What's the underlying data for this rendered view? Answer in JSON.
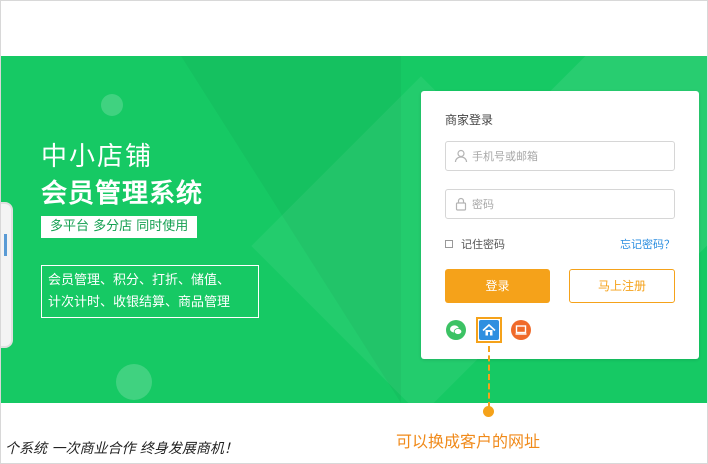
{
  "hero": {
    "title": "中小店铺",
    "subtitle": "会员管理系统",
    "tagline": "多平台 多分店 同时使用",
    "features_line1": "会员管理、积分、打折、储值、",
    "features_line2": "计次计时、收银结算、商品管理"
  },
  "login": {
    "title": "商家登录",
    "phone_placeholder": "手机号或邮箱",
    "password_placeholder": "密码",
    "remember_label": "记住密码",
    "forgot_label": "忘记密码？",
    "login_button": "登录",
    "register_button": "马上注册",
    "icons": [
      "wechat-icon",
      "home-icon",
      "computer-icon"
    ]
  },
  "annotation": {
    "text": "可以换成客户的网址"
  },
  "footer": {
    "slogan": "个系统 一次商业合作 终身发展商机！"
  },
  "colors": {
    "green": "#16c964",
    "orange": "#f5a21a",
    "link": "#2a8ee0"
  }
}
